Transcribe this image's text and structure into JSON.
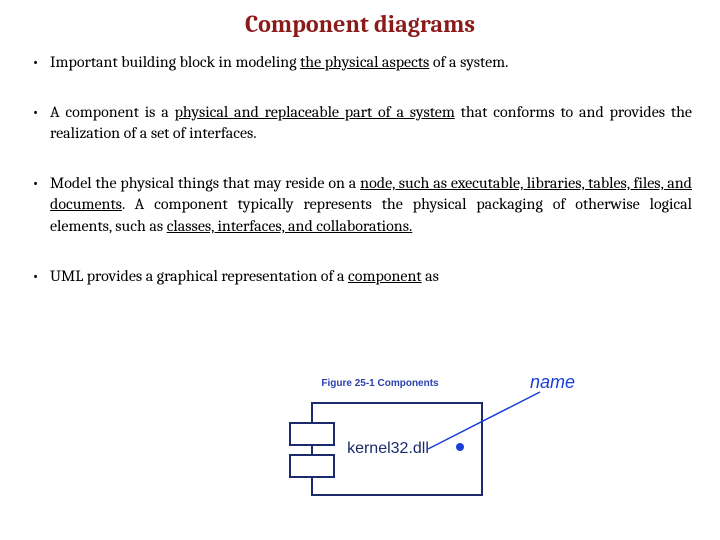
{
  "title": "Component diagrams",
  "bullets": {
    "b1": {
      "t1": "Important building block in modeling ",
      "u1": "the physical aspects",
      "t2": " of a system."
    },
    "b2": {
      "t1": " A component is a ",
      "u1": "physical and replaceable part of a system",
      "t2": " that conforms to and provides the realization of a set of interfaces."
    },
    "b3": {
      "t1": "Model the physical things that may reside on a ",
      "u1": "node, such as executable, libraries, tables, files, and documents",
      "t2": ". A component typically represents the physical packaging of otherwise logical elements, such as ",
      "u2": "classes, interfaces, and collaborations."
    },
    "b4": {
      "t1": "UML provides a graphical representation of a ",
      "u1": "component",
      "t2": " as"
    }
  },
  "figure": {
    "caption": "Figure 25-1 Components",
    "component_text": "kernel32.dll",
    "pointer_label": "name"
  }
}
